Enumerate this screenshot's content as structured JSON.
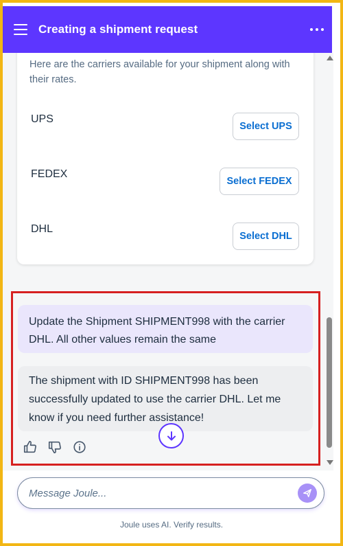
{
  "header": {
    "title": "Creating a shipment request",
    "background": "#5d36ff"
  },
  "carriers_card": {
    "intro": "Here are the carriers available for your shipment along with their rates.",
    "carriers": [
      {
        "name": "UPS",
        "button": "Select UPS"
      },
      {
        "name": "FEDEX",
        "button": "Select FEDEX"
      },
      {
        "name": "DHL",
        "button": "Select DHL"
      }
    ]
  },
  "messages": {
    "user": "Update the Shipment SHIPMENT998 with the carrier DHL. All other values remain the same",
    "assistant": "The shipment with ID SHIPMENT998 has been successfully updated to use the carrier DHL. Let me know if you need further assistance!"
  },
  "feedback_icons": [
    "thumbs-up-icon",
    "thumbs-down-icon",
    "info-icon"
  ],
  "input": {
    "placeholder": "Message Joule...",
    "value": ""
  },
  "footer": {
    "note": "Joule uses AI. Verify results."
  },
  "colors": {
    "brand": "#5d36ff",
    "link": "#0a6ed1",
    "highlight_border": "#d62020",
    "outer_border": "#f2b614"
  }
}
